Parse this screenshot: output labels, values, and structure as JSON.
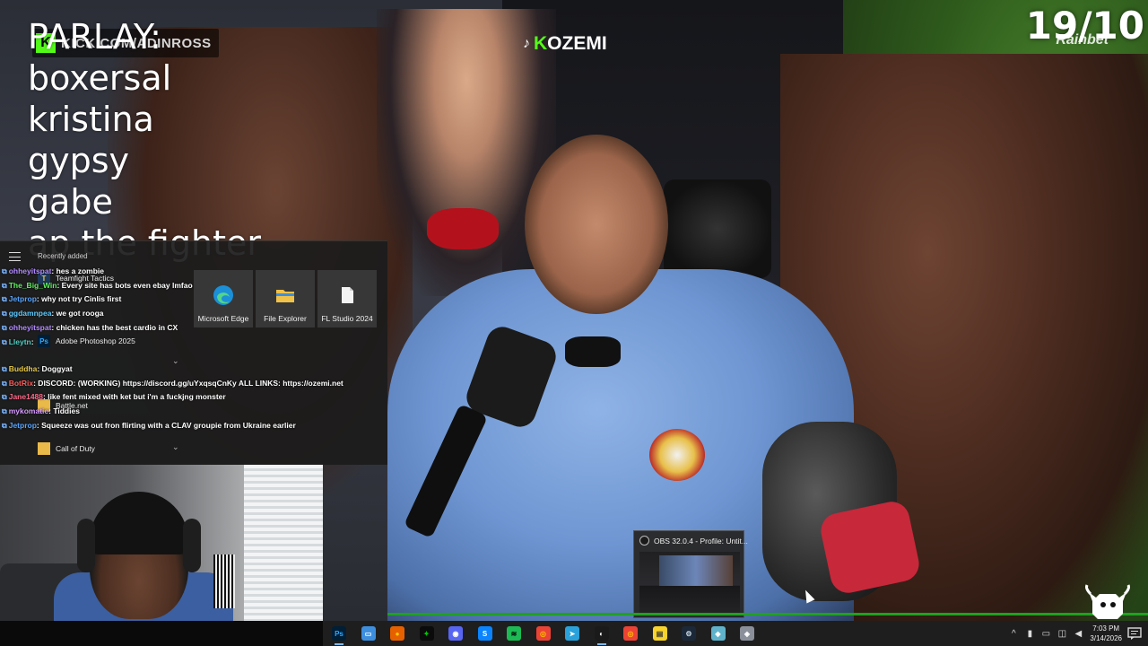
{
  "overlay": {
    "parlay_lines": [
      "PARLAY:",
      "boxersal",
      "kristina",
      "gypsy",
      "gabe",
      "ap the fighter"
    ],
    "kick_url": "KICK.COM/ADINROSS",
    "tiktok_handle_prefix": "K",
    "tiktok_handle_rest": "OZEMI",
    "score": "19/10",
    "watermark": "Rainbet"
  },
  "start_menu": {
    "recently_added_label": "Recently added",
    "apps": [
      {
        "label": "Teamfight Tactics",
        "icon": "tft-icon"
      },
      {
        "label": "Adobe Photoshop 2025",
        "icon": "photoshop-icon"
      },
      {
        "label": "Battle.net",
        "icon": "folder-icon"
      },
      {
        "label": "Call of Duty",
        "icon": "folder-icon"
      }
    ],
    "tiles": [
      {
        "label": "Microsoft Edge",
        "icon": "edge-icon"
      },
      {
        "label": "File Explorer",
        "icon": "folder-icon"
      },
      {
        "label": "FL Studio 2024",
        "icon": "file-icon"
      }
    ]
  },
  "chat": [
    {
      "user": "ohheyitspat",
      "color": "#b38cff",
      "msg": ": hes a zombie"
    },
    {
      "user": "The_Big_Win",
      "color": "#5ff25f",
      "msg": ": Every site has bots even ebay lmfao"
    },
    {
      "user": "Jetprop",
      "color": "#58a6ff",
      "msg": ": why not try Cinlis first"
    },
    {
      "user": "ggdamnpea",
      "color": "#5ecbff",
      "msg": ": we got rooga"
    },
    {
      "user": "ohheyitspat",
      "color": "#b38cff",
      "msg": ": chicken has the best cardio in CX"
    },
    {
      "user": "Lleytn",
      "color": "#4fd1c5",
      "msg": ": "
    },
    {
      "user": "",
      "color": "#ffffff",
      "msg": ""
    },
    {
      "user": "Buddha",
      "color": "#e6c84a",
      "msg": ": Doggyat"
    },
    {
      "user": "BotRix",
      "color": "#ff5a5a",
      "msg": ": DISCORD: (WORKING) https://discord.gg/uYxqsqCnKy ALL LINKS: https://ozemi.net"
    },
    {
      "user": "Jane1488",
      "color": "#ff6b8a",
      "msg": ": like fent mixed with ket but i'm a fuckjng monster"
    },
    {
      "user": "mykomatic",
      "color": "#d69cff",
      "msg": ": Tiddies"
    },
    {
      "user": "Jetprop",
      "color": "#58a6ff",
      "msg": ": Squeeze was out fron flirting with a CLAV groupie from Ukraine earlier"
    }
  ],
  "obs": {
    "title": "OBS 32.0.4 - Profile: Untit..."
  },
  "taskbar": {
    "icons": [
      "photoshop-icon",
      "file-explorer-icon",
      "firefox-icon",
      "robinhood-icon",
      "discord-icon",
      "shazam-icon",
      "spotify-icon",
      "chrome-icon",
      "telegram-icon",
      "obs-icon",
      "chrome-icon",
      "notes-icon",
      "steam-icon",
      "app-icon",
      "shield-icon"
    ],
    "time": "7:03 PM",
    "date": "3/14/2026"
  },
  "colors": {
    "kick_green": "#53fc18",
    "taskbar_bg": "#1e1e1f",
    "seek_bar": "#1fa11f"
  }
}
